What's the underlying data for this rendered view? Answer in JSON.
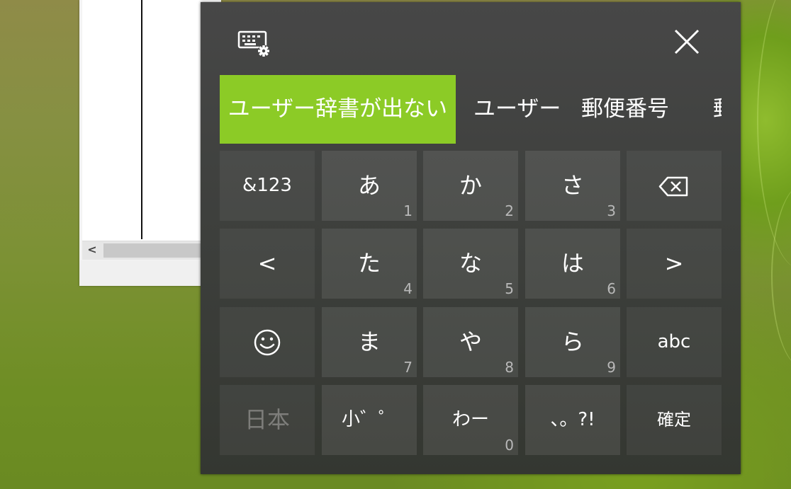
{
  "background_window": {
    "scroll_left_label": "<"
  },
  "keyboard": {
    "settings_icon": "keyboard-settings-icon",
    "close_icon": "close-icon",
    "accent_color": "#8ccb26",
    "candidates": [
      {
        "label": "ユーザー辞書が出ない",
        "selected": true
      },
      {
        "label": "ユーザー",
        "selected": false
      },
      {
        "label": "郵便番号",
        "selected": false
      },
      {
        "label": "郵",
        "selected": false
      }
    ],
    "keys": {
      "symbols": {
        "label": "&123"
      },
      "a": {
        "label": "あ",
        "number": "1"
      },
      "ka": {
        "label": "か",
        "number": "2"
      },
      "sa": {
        "label": "さ",
        "number": "3"
      },
      "backspace": {
        "icon": "backspace-icon"
      },
      "cursor_left": {
        "label": "<"
      },
      "ta": {
        "label": "た",
        "number": "4"
      },
      "na": {
        "label": "な",
        "number": "5"
      },
      "ha": {
        "label": "は",
        "number": "6"
      },
      "cursor_right": {
        "label": ">"
      },
      "emoji": {
        "icon": "emoji-icon"
      },
      "ma": {
        "label": "ま",
        "number": "7"
      },
      "ya": {
        "label": "や",
        "number": "8"
      },
      "ra": {
        "label": "ら",
        "number": "9"
      },
      "abc": {
        "label": "abc"
      },
      "language": {
        "label": "日本"
      },
      "small_dakuten": {
        "label": "小゛゜"
      },
      "wa": {
        "label": "わー",
        "number": "0"
      },
      "punctuation": {
        "label": "、。?!"
      },
      "confirm": {
        "label": "確定"
      }
    }
  }
}
